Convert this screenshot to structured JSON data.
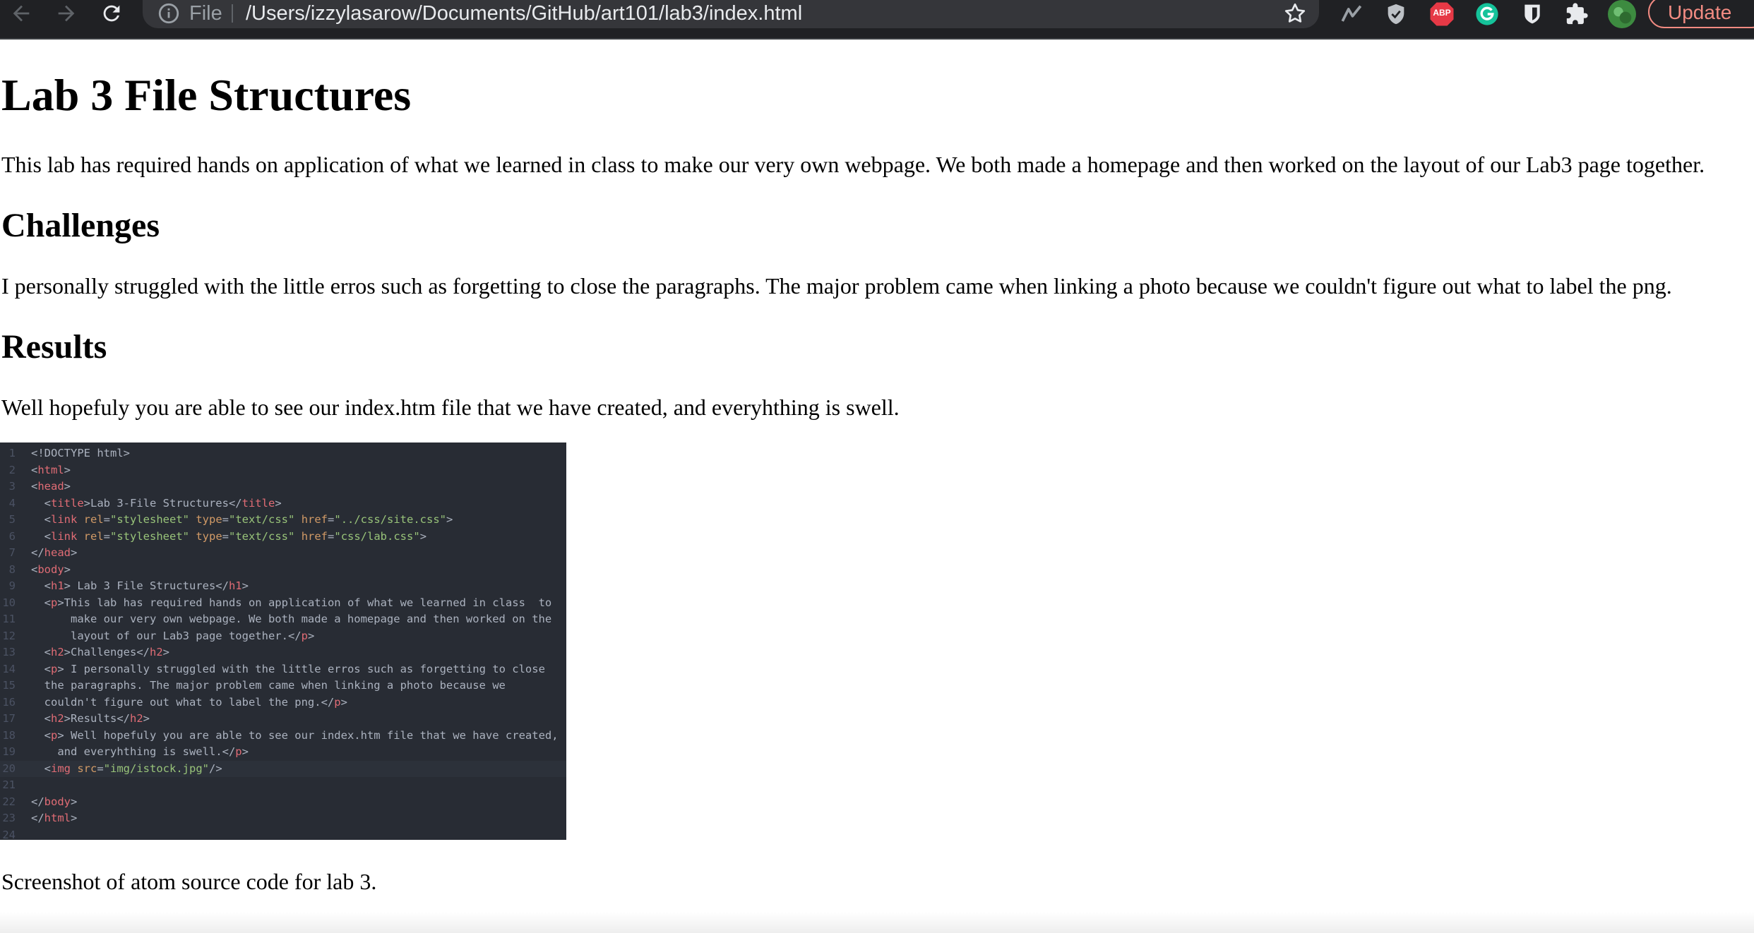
{
  "browser": {
    "scheme_label": "File",
    "url": "/Users/izzylasarow/Documents/GitHub/art101/lab3/index.html",
    "update_label": "Update",
    "extensions": [
      "analytics-extension-icon",
      "shield-extension-icon",
      "adblock-plus-icon",
      "grammarly-icon",
      "bitwarden-icon",
      "extensions-puzzle-icon",
      "profile-avatar"
    ],
    "abp_label": "ABP",
    "accent_color": "#f28b82"
  },
  "page": {
    "title": "Lab 3 File Structures",
    "intro": "This lab has required hands on application of what we learned in class to make our very own webpage. We both made a homepage and then worked on the layout of our Lab3 page together.",
    "challenges_heading": "Challenges",
    "challenges_text": "I personally struggled with the little erros such as forgetting to close the paragraphs. The major problem came when linking a photo because we couldn't figure out what to label the png.",
    "results_heading": "Results",
    "results_text": "Well hopefuly you are able to see our index.htm file that we have created, and everyhthing is swell.",
    "caption": "Screenshot of atom source code for lab 3."
  },
  "code_lines": [
    {
      "n": "1",
      "text": "<!DOCTYPE html>"
    },
    {
      "n": "2",
      "text": "<html>"
    },
    {
      "n": "3",
      "text": "<head>"
    },
    {
      "n": "4",
      "text": "  <title>Lab 3-File Structures</title>"
    },
    {
      "n": "5",
      "text": "  <link rel=\"stylesheet\" type=\"text/css\" href=\"../css/site.css\">"
    },
    {
      "n": "6",
      "text": "  <link rel=\"stylesheet\" type=\"text/css\" href=\"css/lab.css\">"
    },
    {
      "n": "7",
      "text": "</head>"
    },
    {
      "n": "8",
      "text": "<body>"
    },
    {
      "n": "9",
      "text": "  <h1> Lab 3 File Structures</h1>"
    },
    {
      "n": "10",
      "text": "  <p>This lab has required hands on application of what we learned in class  to"
    },
    {
      "n": "11",
      "text": "      make our very own webpage. We both made a homepage and then worked on the"
    },
    {
      "n": "12",
      "text": "      layout of our Lab3 page together.</p>"
    },
    {
      "n": "13",
      "text": "  <h2>Challenges</h2>"
    },
    {
      "n": "14",
      "text": "  <p> I personally struggled with the little erros such as forgetting to close"
    },
    {
      "n": "15",
      "text": "  the paragraphs. The major problem came when linking a photo because we"
    },
    {
      "n": "16",
      "text": "  couldn't figure out what to label the png.</p>"
    },
    {
      "n": "17",
      "text": "  <h2>Results</h2>"
    },
    {
      "n": "18",
      "text": "  <p> Well hopefuly you are able to see our index.htm file that we have created,"
    },
    {
      "n": "19",
      "text": "    and everyhthing is swell.</p>"
    },
    {
      "n": "20",
      "text": "  <img src=\"img/istock.jpg\"/>"
    },
    {
      "n": "21",
      "text": ""
    },
    {
      "n": "22",
      "text": "</body>"
    },
    {
      "n": "23",
      "text": "</html>"
    },
    {
      "n": "24",
      "text": ""
    }
  ],
  "code_active_line": "20"
}
